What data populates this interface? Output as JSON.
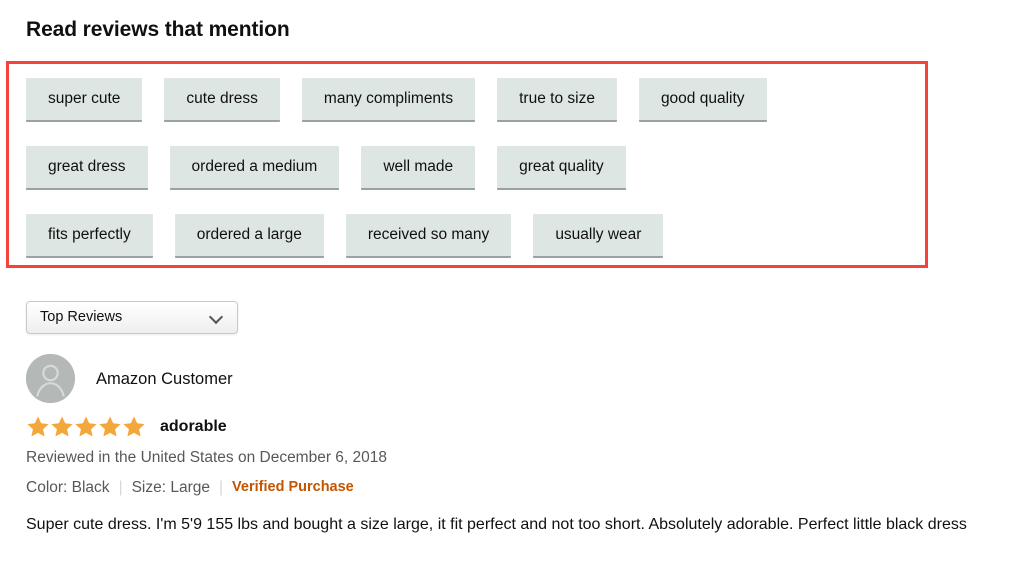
{
  "section": {
    "title": "Read reviews that mention"
  },
  "colors": {
    "highlight_border": "#f4433b",
    "tag_background": "#dee6e4",
    "star_gold": "#f2a83b",
    "verified_orange": "#c45500",
    "muted_text": "#565959"
  },
  "lexicon_tags": {
    "rows": [
      [
        "super cute",
        "cute dress",
        "many compliments",
        "true to size",
        "good quality"
      ],
      [
        "great dress",
        "ordered a medium",
        "well made",
        "great quality"
      ],
      [
        "fits perfectly",
        "ordered a large",
        "received so many",
        "usually wear"
      ]
    ]
  },
  "sort_dropdown": {
    "selected": "Top Reviews",
    "chevron_icon": "chevron-down-icon"
  },
  "review": {
    "author": "Amazon Customer",
    "avatar_icon": "user-avatar-icon",
    "rating": 5,
    "rating_max": 5,
    "title": "adorable",
    "date_line": "Reviewed in the United States on December 6, 2018",
    "color_attr": "Color: Black",
    "size_attr": "Size: Large",
    "verified_label": "Verified Purchase",
    "separator": "|",
    "body": "Super cute dress. I'm 5'9 155 lbs and bought a size large, it fit perfect and not too short. Absolutely adorable. Perfect little black dress"
  }
}
